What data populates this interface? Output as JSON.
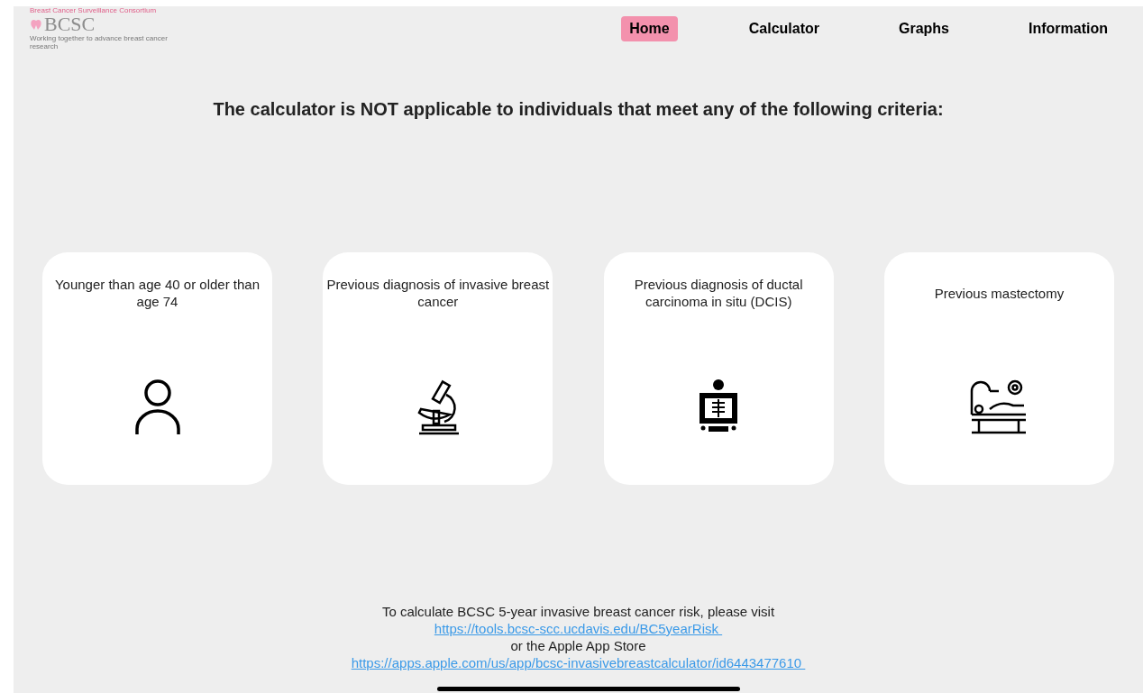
{
  "logo": {
    "tagline_top": "Breast Cancer Surveillance Consortium",
    "wordmark": "BCSC",
    "tagline": "Working together to advance breast cancer research"
  },
  "nav": [
    {
      "label": "Home",
      "selected": true
    },
    {
      "label": "Calculator",
      "selected": false
    },
    {
      "label": "Graphs",
      "selected": false
    },
    {
      "label": "Information",
      "selected": false
    }
  ],
  "heading": "The calculator is NOT applicable to individuals that meet any of the following criteria:",
  "criteria": [
    {
      "text": "Younger than age 40 or older than age 74",
      "kind": "person"
    },
    {
      "text": "Previous diagnosis of invasive breast cancer",
      "kind": "microscope"
    },
    {
      "text": "Previous diagnosis of ductal carcinoma in situ (DCIS)",
      "kind": "xray"
    },
    {
      "text": "Previous mastectomy",
      "kind": "surgery"
    }
  ],
  "footer": {
    "line1": "To calculate BCSC 5-year invasive breast cancer risk, please visit",
    "link1": "https://tools.bcsc-scc.ucdavis.edu/BC5yearRisk ",
    "line2": "or the Apple App Store",
    "link2": "https://apps.apple.com/us/app/bcsc-invasivebreastcalculator/id6443477610 "
  }
}
